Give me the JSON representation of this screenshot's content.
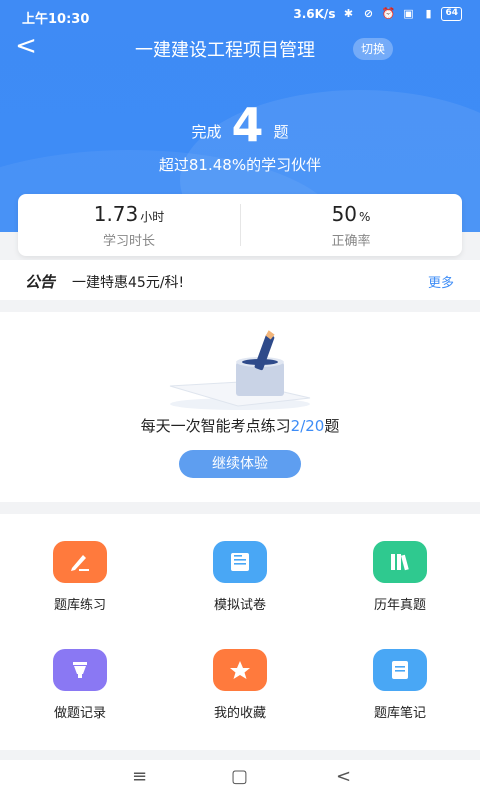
{
  "status_bar": {
    "time": "上午10:30",
    "speed": "3.6K/s",
    "battery": "64"
  },
  "nav": {
    "back": "<",
    "title": "一建建设工程项目管理",
    "switch": "切换"
  },
  "summary": {
    "done_prefix": "完成",
    "done_count": "4",
    "done_suffix": "题",
    "beat": "超过81.48%的学习伙伴"
  },
  "stats": [
    {
      "value": "1.73",
      "unit": "小时",
      "label": "学习时长"
    },
    {
      "value": "50",
      "unit": "%",
      "label": "正确率"
    }
  ],
  "notice": {
    "tag": "公告",
    "text": "一建特惠45元/科!",
    "more": "更多"
  },
  "practice": {
    "text_before": "每天一次智能考点练习",
    "progress": "2/20",
    "text_after": "题",
    "button": "继续体验"
  },
  "menu": [
    {
      "label": "题库练习",
      "icon": "pencil-edit-icon",
      "color": "#ff7a3d"
    },
    {
      "label": "模拟试卷",
      "icon": "test-paper-icon",
      "color": "#49a7f5"
    },
    {
      "label": "历年真题",
      "icon": "books-icon",
      "color": "#2fc98f"
    },
    {
      "label": "做题记录",
      "icon": "pen-nib-icon",
      "color": "#8a78f3"
    },
    {
      "label": "我的收藏",
      "icon": "star-icon",
      "color": "#ff7a3d"
    },
    {
      "label": "题库笔记",
      "icon": "note-icon",
      "color": "#49a7f5"
    }
  ],
  "system_nav": {
    "menu": "≡",
    "home": "▢",
    "back": "<"
  }
}
